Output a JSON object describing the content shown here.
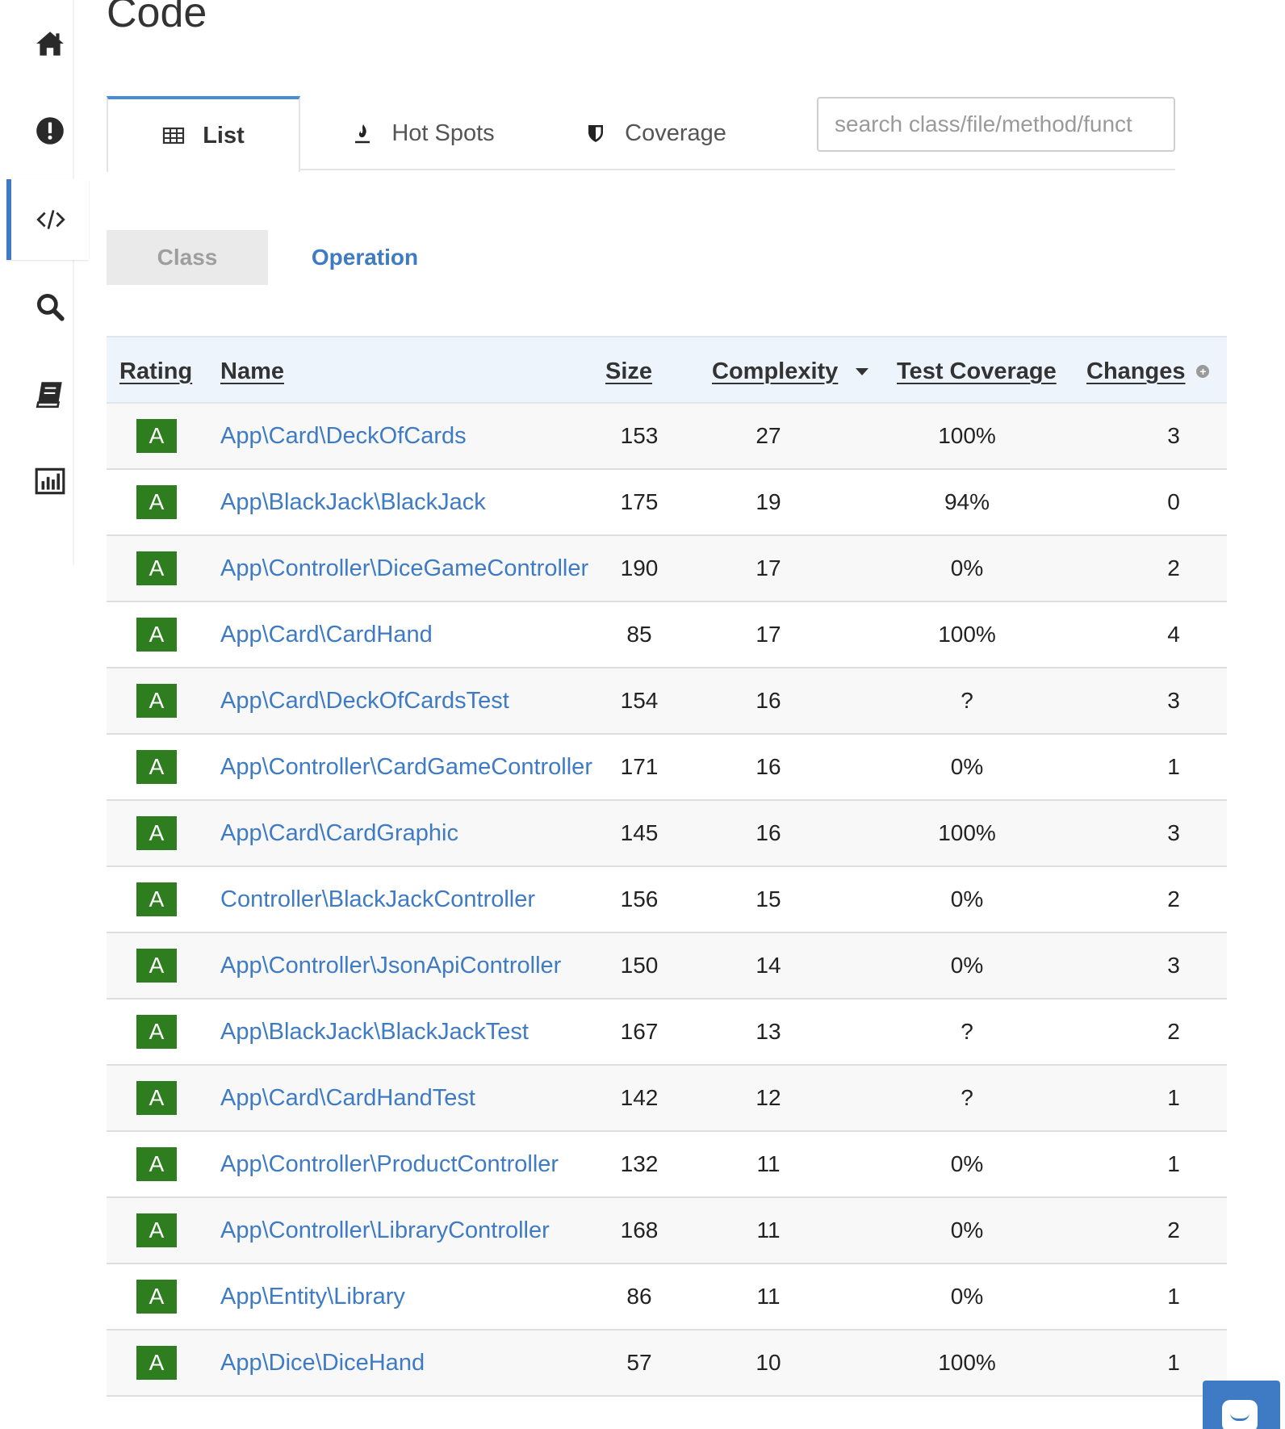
{
  "page": {
    "title": "Code"
  },
  "sidebar": {
    "items": [
      {
        "icon": "home-icon"
      },
      {
        "icon": "exclamation-icon"
      },
      {
        "icon": "code-icon",
        "active": true
      },
      {
        "icon": "search-icon"
      },
      {
        "icon": "book-icon"
      },
      {
        "icon": "chart-icon"
      }
    ]
  },
  "tabs": {
    "list": "List",
    "hotspots": "Hot Spots",
    "coverage": "Coverage"
  },
  "search": {
    "placeholder": "search class/file/method/funct",
    "value": ""
  },
  "toggle": {
    "class": "Class",
    "operation": "Operation"
  },
  "table": {
    "headers": {
      "rating": "Rating",
      "name": "Name",
      "size": "Size",
      "complexity": "Complexity",
      "coverage": "Test Coverage",
      "changes": "Changes"
    },
    "rows": [
      {
        "rating": "A",
        "name": "App\\Card\\DeckOfCards",
        "size": "153",
        "complexity": "27",
        "coverage": "100%",
        "changes": "3"
      },
      {
        "rating": "A",
        "name": "App\\BlackJack\\BlackJack",
        "size": "175",
        "complexity": "19",
        "coverage": "94%",
        "changes": "0"
      },
      {
        "rating": "A",
        "name": "App\\Controller\\DiceGameController",
        "size": "190",
        "complexity": "17",
        "coverage": "0%",
        "changes": "2"
      },
      {
        "rating": "A",
        "name": "App\\Card\\CardHand",
        "size": "85",
        "complexity": "17",
        "coverage": "100%",
        "changes": "4"
      },
      {
        "rating": "A",
        "name": "App\\Card\\DeckOfCardsTest",
        "size": "154",
        "complexity": "16",
        "coverage": "?",
        "changes": "3"
      },
      {
        "rating": "A",
        "name": "App\\Controller\\CardGameController",
        "size": "171",
        "complexity": "16",
        "coverage": "0%",
        "changes": "1"
      },
      {
        "rating": "A",
        "name": "App\\Card\\CardGraphic",
        "size": "145",
        "complexity": "16",
        "coverage": "100%",
        "changes": "3"
      },
      {
        "rating": "A",
        "name": "Controller\\BlackJackController",
        "size": "156",
        "complexity": "15",
        "coverage": "0%",
        "changes": "2"
      },
      {
        "rating": "A",
        "name": "App\\Controller\\JsonApiController",
        "size": "150",
        "complexity": "14",
        "coverage": "0%",
        "changes": "3"
      },
      {
        "rating": "A",
        "name": "App\\BlackJack\\BlackJackTest",
        "size": "167",
        "complexity": "13",
        "coverage": "?",
        "changes": "2"
      },
      {
        "rating": "A",
        "name": "App\\Card\\CardHandTest",
        "size": "142",
        "complexity": "12",
        "coverage": "?",
        "changes": "1"
      },
      {
        "rating": "A",
        "name": "App\\Controller\\ProductController",
        "size": "132",
        "complexity": "11",
        "coverage": "0%",
        "changes": "1"
      },
      {
        "rating": "A",
        "name": "App\\Controller\\LibraryController",
        "size": "168",
        "complexity": "11",
        "coverage": "0%",
        "changes": "2"
      },
      {
        "rating": "A",
        "name": "App\\Entity\\Library",
        "size": "86",
        "complexity": "11",
        "coverage": "0%",
        "changes": "1"
      },
      {
        "rating": "A",
        "name": "App\\Dice\\DiceHand",
        "size": "57",
        "complexity": "10",
        "coverage": "100%",
        "changes": "1"
      }
    ]
  },
  "colors": {
    "accent": "#3e7bc4",
    "rating_a": "#2e7d1f",
    "header_bg": "#edf4fb"
  }
}
